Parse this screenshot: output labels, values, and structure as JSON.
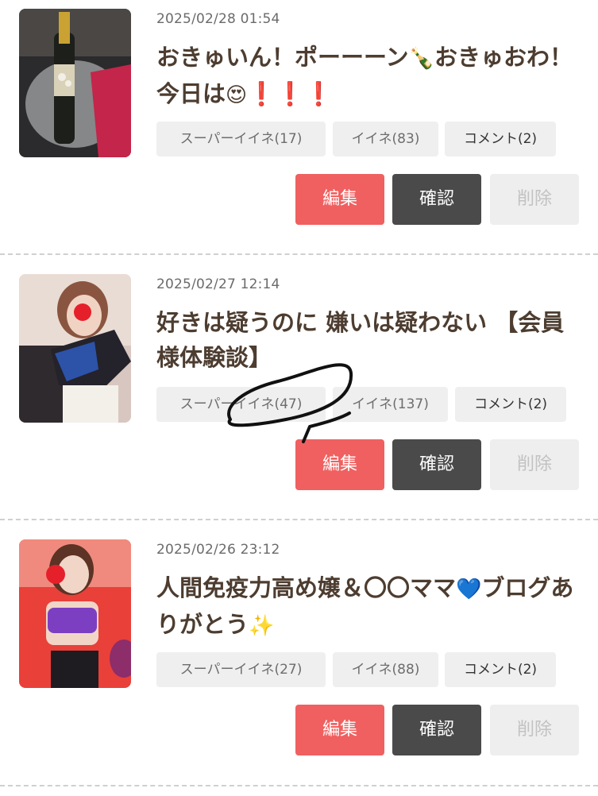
{
  "posts": [
    {
      "date": "2025/02/28 01:54",
      "title_parts": [
        "おきゅいん！ポーーーン",
        "🍾",
        "おきゅおわ！今日は",
        "😍",
        "❗️❗️❗️"
      ],
      "stats": {
        "super_like": "スーパーイイネ(17)",
        "like": "イイネ(83)",
        "comment": "コメント(2)"
      },
      "buttons": {
        "edit": "編集",
        "confirm": "確認",
        "delete": "削除"
      }
    },
    {
      "date": "2025/02/27 12:14",
      "title_parts": [
        "好きは疑うのに 嫌いは疑わない 【会員様体験談】"
      ],
      "stats": {
        "super_like": "スーパーイイネ(47)",
        "like": "イイネ(137)",
        "comment": "コメント(2)"
      },
      "buttons": {
        "edit": "編集",
        "confirm": "確認",
        "delete": "削除"
      }
    },
    {
      "date": "2025/02/26 23:12",
      "title_parts": [
        "人間免疫力高め嬢＆〇〇ママ",
        "💙",
        "ブログありがとう",
        "✨"
      ],
      "stats": {
        "super_like": "スーパーイイネ(27)",
        "like": "イイネ(88)",
        "comment": "コメント(2)"
      },
      "buttons": {
        "edit": "編集",
        "confirm": "確認",
        "delete": "削除"
      }
    }
  ],
  "colors": {
    "edit_button": "#f06060",
    "confirm_button": "#4a4a4a",
    "delete_button": "#eeeeee",
    "stat_chip": "#efefef",
    "title_text": "#4d3d30"
  }
}
